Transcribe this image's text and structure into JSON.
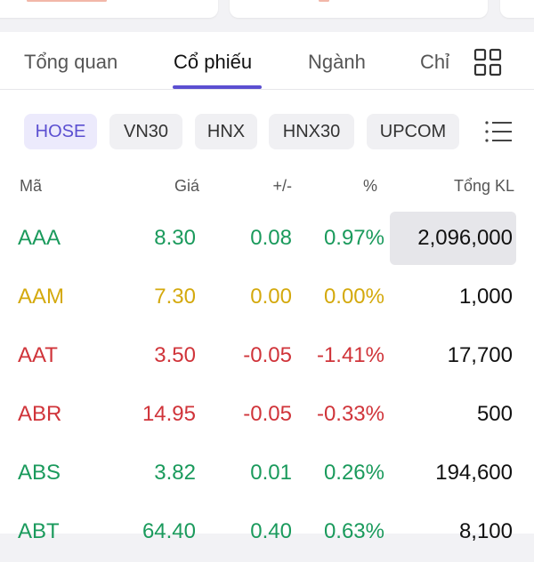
{
  "tabs": [
    {
      "label": "Tổng quan"
    },
    {
      "label": "Cổ phiếu"
    },
    {
      "label": "Ngành"
    },
    {
      "label": "Chỉ"
    }
  ],
  "icons": {
    "grid": "grid-icon",
    "menu": "list-menu-icon"
  },
  "exchanges": [
    {
      "label": "HOSE"
    },
    {
      "label": "VN30"
    },
    {
      "label": "HNX"
    },
    {
      "label": "HNX30"
    },
    {
      "label": "UPCOM"
    }
  ],
  "columns": {
    "symbol": "Mã",
    "price": "Giá",
    "change": "+/-",
    "percent": "%",
    "volume": "Tổng KL"
  },
  "colors": {
    "accent": "#5b4fd1",
    "up": "#1a9a5c",
    "reference": "#d4a90d",
    "down": "#d0343a"
  },
  "rows": [
    {
      "symbol": "AAA",
      "price": "8.30",
      "change": "0.08",
      "percent": "0.97%",
      "volume": "2,096,000",
      "trend": "up"
    },
    {
      "symbol": "AAM",
      "price": "7.30",
      "change": "0.00",
      "percent": "0.00%",
      "volume": "1,000",
      "trend": "ref"
    },
    {
      "symbol": "AAT",
      "price": "3.50",
      "change": "-0.05",
      "percent": "-1.41%",
      "volume": "17,700",
      "trend": "down"
    },
    {
      "symbol": "ABR",
      "price": "14.95",
      "change": "-0.05",
      "percent": "-0.33%",
      "volume": "500",
      "trend": "down"
    },
    {
      "symbol": "ABS",
      "price": "3.82",
      "change": "0.01",
      "percent": "0.26%",
      "volume": "194,600",
      "trend": "up"
    },
    {
      "symbol": "ABT",
      "price": "64.40",
      "change": "0.40",
      "percent": "0.63%",
      "volume": "8,100",
      "trend": "up"
    }
  ]
}
